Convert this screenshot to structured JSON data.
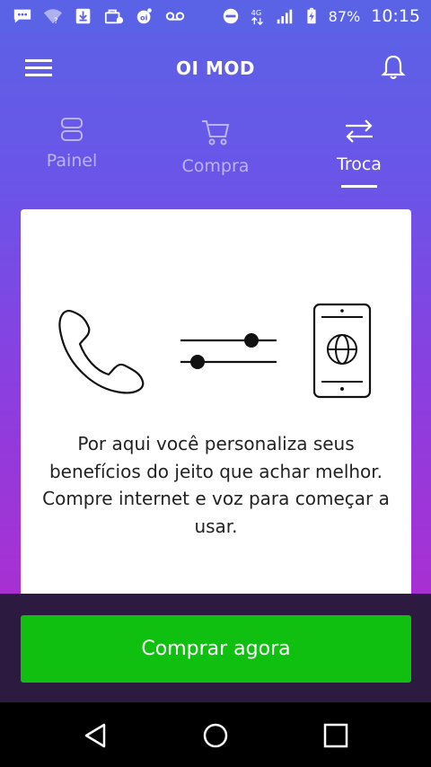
{
  "status_bar": {
    "battery_percent": "87%",
    "time": "10:15",
    "network_label": "4G",
    "icons": [
      "chat-icon",
      "wifi-question-icon",
      "download-icon",
      "shopping-icon",
      "oi-icon",
      "voicemail-icon",
      "do-not-disturb-icon",
      "network-4g-icon",
      "signal-icon",
      "battery-charging-icon"
    ]
  },
  "header": {
    "title": "OI MOD",
    "menu_icon": "hamburger-menu-icon",
    "notifications_icon": "bell-icon"
  },
  "tabs": [
    {
      "label": "Painel",
      "icon": "panel-icon",
      "active": false
    },
    {
      "label": "Compra",
      "icon": "cart-icon",
      "active": false
    },
    {
      "label": "Troca",
      "icon": "swap-arrows-icon",
      "active": true
    }
  ],
  "card": {
    "illustration_icons": [
      "phone-handset-icon",
      "sliders-icon",
      "smartphone-globe-icon"
    ],
    "description": "Por aqui você personaliza seus benefícios do jeito que achar melhor. Compre internet e voz para começar a usar."
  },
  "actions": {
    "buy_label": "Comprar agora"
  },
  "colors": {
    "accent_green": "#10c010",
    "header_blue": "#5a63e6",
    "gradient_purple": "#a830d2",
    "bottom_dark": "#2c1a40"
  },
  "nav_bar": {
    "icons": [
      "back-icon",
      "home-icon",
      "recents-icon"
    ]
  }
}
